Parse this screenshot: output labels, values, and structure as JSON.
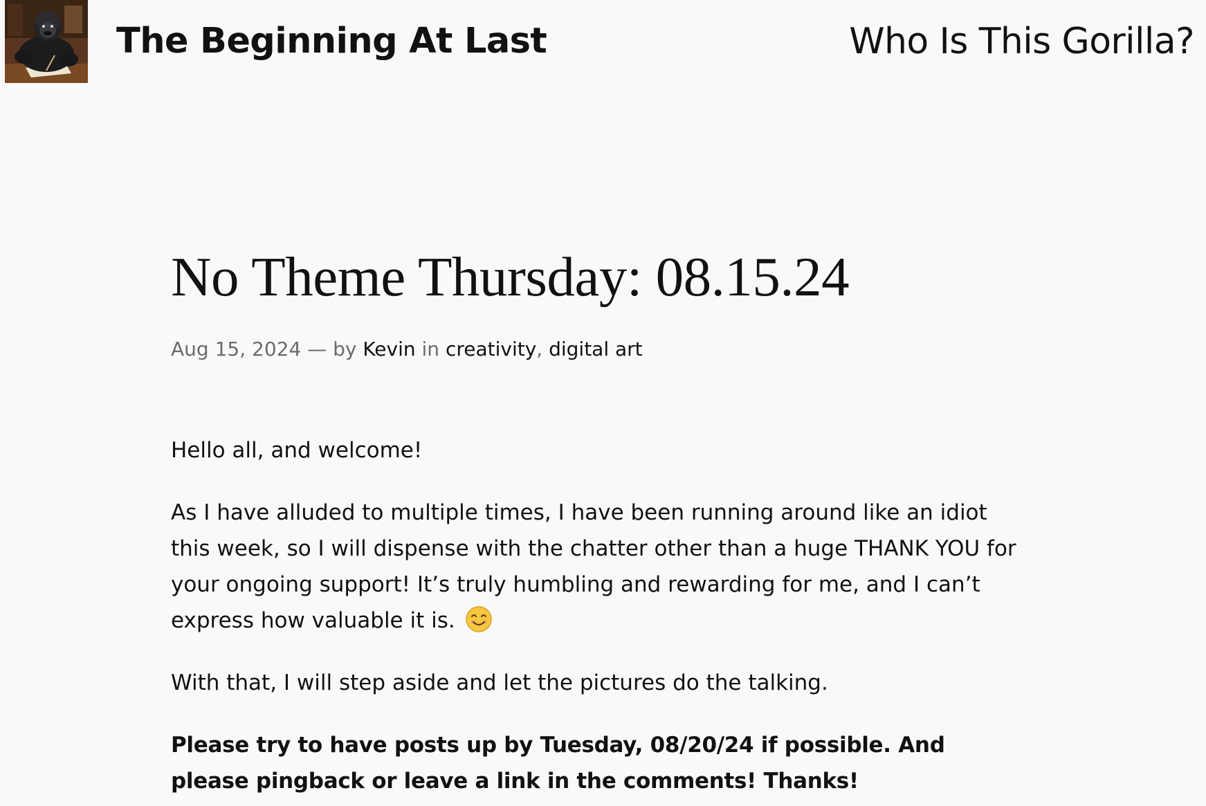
{
  "header": {
    "site_title": "The Beginning At Last",
    "logo_icon": "gorilla-writing-avatar",
    "nav": [
      {
        "label": "Who Is This Gorilla?"
      }
    ]
  },
  "post": {
    "title": "No Theme Thursday: 08.15.24",
    "meta": {
      "date": "Aug 15, 2024",
      "separator": " — by ",
      "author": "Kevin",
      "in_label": " in ",
      "categories": [
        "creativity",
        "digital art"
      ],
      "category_separator": ", "
    },
    "paragraphs": [
      "Hello all, and welcome!",
      "As I have alluded to multiple times, I have been running around like an idiot this week, so I will dispense with the chatter other than a huge THANK YOU for your ongoing support! It’s truly humbling and rewarding for me, and I can’t express how valuable it is.",
      "With that, I will step aside and let the pictures do the talking.",
      "Please try to have posts up by Tuesday, 08/20/24 if possible. And please pingback or leave a link in the comments! Thanks!"
    ],
    "emoji_icon": "smiling-face-icon"
  },
  "colors": {
    "background": "#f9f9f9",
    "text": "#111111",
    "meta_muted": "#6b6b6b"
  }
}
